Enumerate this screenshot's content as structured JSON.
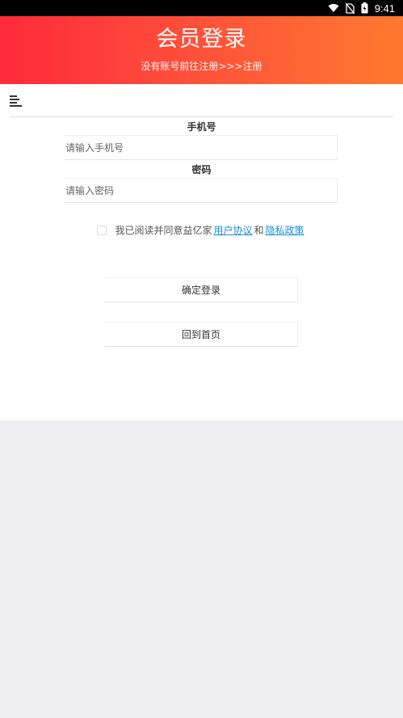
{
  "status_bar": {
    "time": "9:41",
    "icons": [
      "wifi-icon",
      "no-sim-icon",
      "battery-icon"
    ]
  },
  "header": {
    "title": "会员登录",
    "subtitle": "没有账号前往注册>>>注册"
  },
  "toolbar": {
    "menu_icon": "menu-icon"
  },
  "form": {
    "phone_label": "手机号",
    "phone_placeholder": "请输入手机号",
    "password_label": "密码",
    "password_placeholder": "请输入密码"
  },
  "agreement": {
    "prefix": "我已阅读并同意益亿家",
    "user_agreement": "用户协议",
    "conjunction": "和",
    "privacy_policy": "隐私政策",
    "checked": false
  },
  "buttons": {
    "login": "确定登录",
    "home": "回到首页"
  },
  "colors": {
    "header_gradient_start": "#ff2a3b",
    "header_gradient_end": "#ff7a30",
    "link": "#1a8fd6",
    "background": "#eeedf1"
  }
}
